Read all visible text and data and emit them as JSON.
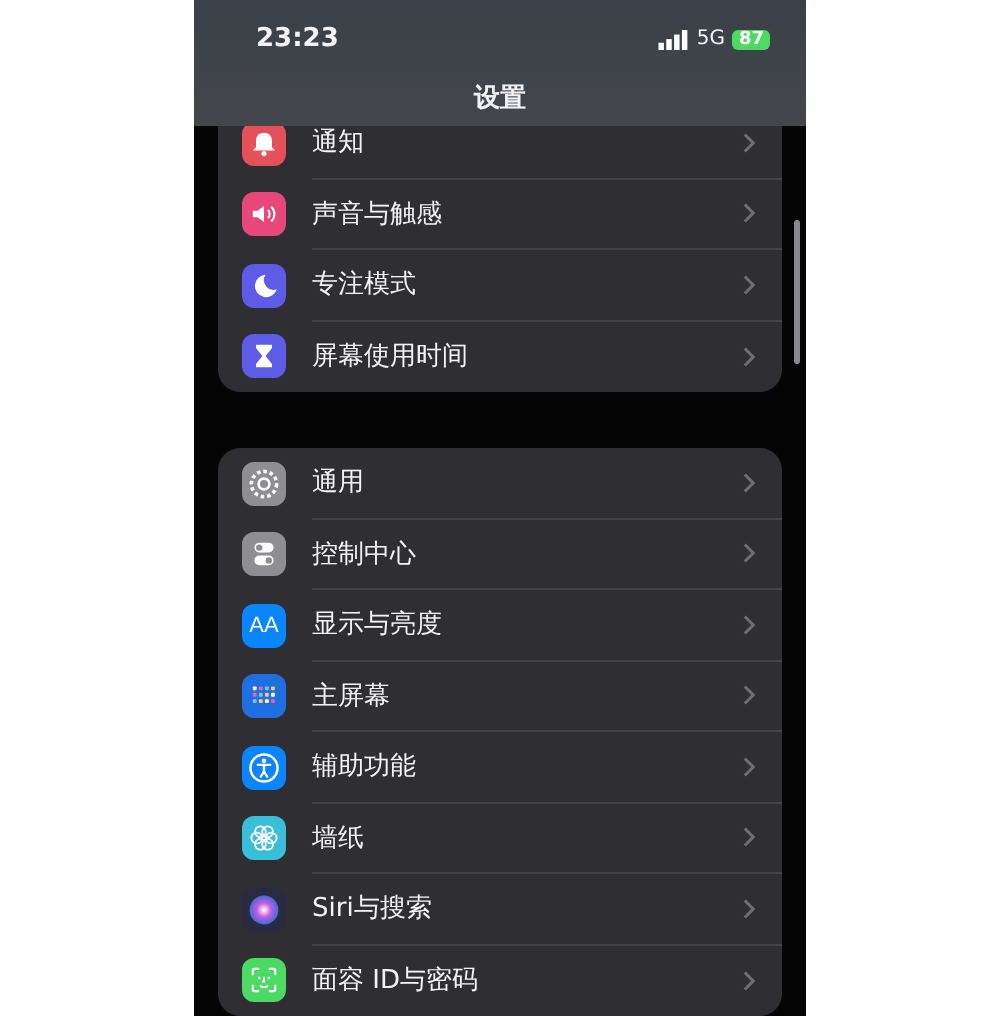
{
  "status_bar": {
    "time": "23:23",
    "network": "5G",
    "battery": "87"
  },
  "title": "设置",
  "groups": [
    {
      "items": [
        {
          "label": "通知",
          "kind": "bell",
          "color": "#e5505a"
        },
        {
          "label": "声音与触感",
          "kind": "speaker",
          "color": "#e8477c"
        },
        {
          "label": "专注模式",
          "kind": "moon",
          "color": "#5e5ce6"
        },
        {
          "label": "屏幕使用时间",
          "kind": "hourglass",
          "color": "#5e5ce6"
        }
      ]
    },
    {
      "items": [
        {
          "label": "通用",
          "kind": "gear",
          "color": "#8e8e93"
        },
        {
          "label": "控制中心",
          "kind": "toggles",
          "color": "#8e8e93"
        },
        {
          "label": "显示与亮度",
          "kind": "letters",
          "icon_text": "AA",
          "color": "#0a84ff"
        },
        {
          "label": "主屏幕",
          "kind": "grid",
          "color": "#1f6fe0"
        },
        {
          "label": "辅助功能",
          "kind": "person",
          "color": "#0a84ff"
        },
        {
          "label": "墙纸",
          "kind": "flower",
          "color": "#3bbfd8"
        },
        {
          "label": "Siri与搜索",
          "kind": "orb",
          "color": "#2a2a40"
        },
        {
          "label": "面容 ID与密码",
          "kind": "face",
          "color": "#4cd964"
        }
      ]
    }
  ]
}
